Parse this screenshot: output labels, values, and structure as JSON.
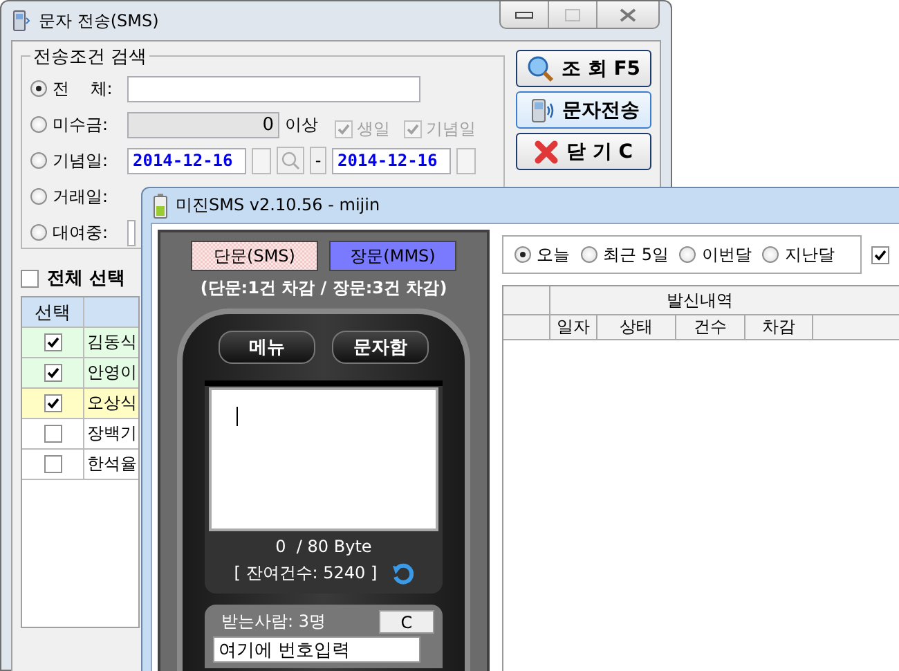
{
  "back_window": {
    "title": "문자 전송(SMS)",
    "search_group": {
      "title": "전송조건 검색",
      "options": [
        {
          "kind": "text",
          "label": "전    체:",
          "selected": true
        },
        {
          "kind": "amount",
          "label": "미수금:",
          "selected": false,
          "value": "0",
          "suffix": "이상",
          "checks": [
            {
              "label": "생일",
              "checked": true
            },
            {
              "label": "기념일",
              "checked": true
            }
          ]
        },
        {
          "kind": "date_range",
          "label": "기념일:",
          "selected": false,
          "from": "2014-12-16",
          "separator": "-",
          "to": "2014-12-16"
        },
        {
          "kind": "covered",
          "label": "거래일:",
          "selected": false
        },
        {
          "kind": "short_text",
          "label": "대여중:",
          "selected": false
        }
      ]
    },
    "buttons": [
      {
        "kind": "search",
        "label": "조 회 F5"
      },
      {
        "kind": "send",
        "label": "문자전송"
      },
      {
        "kind": "close",
        "label": "닫 기 C"
      }
    ],
    "select_all": {
      "label": "전체 선택",
      "checked": false
    },
    "table": {
      "columns": [
        "선택"
      ],
      "rows": [
        {
          "name": "김동식",
          "checked": true,
          "color": "#e4fce4"
        },
        {
          "name": "안영이",
          "checked": true,
          "color": "#e4fce4"
        },
        {
          "name": "오상식",
          "checked": true,
          "color": "#fffcc4"
        },
        {
          "name": "장백기",
          "checked": false,
          "color": "#ffffff"
        },
        {
          "name": "한석율",
          "checked": false,
          "color": "#ffffff"
        }
      ]
    }
  },
  "front_window": {
    "title": "미진SMS v2.10.56 - mijin",
    "message_types": [
      {
        "label": "단문(SMS)",
        "selected": false
      },
      {
        "label": "장문(MMS)",
        "selected": true
      }
    ],
    "deduction_note": "(단문:1건 차감 / 장문:3건 차감)",
    "phone_buttons": [
      "메뉴",
      "문자함"
    ],
    "byte_count": "0  / 80 Byte",
    "remaining": "[ 잔여건수: 5240 ]",
    "recipients": {
      "label": "받는사람: 3명",
      "clear_button": "C",
      "input_value": "여기에 번호입력"
    },
    "periods": [
      {
        "label": "오늘",
        "selected": true
      },
      {
        "label": "최근 5일",
        "selected": false
      },
      {
        "label": "이번달",
        "selected": false
      },
      {
        "label": "지난달",
        "selected": false
      }
    ],
    "filter_checkbox": {
      "checked": true
    },
    "history_table": {
      "group_header": "발신내역",
      "columns": [
        "일자",
        "상태",
        "건수",
        "차감"
      ]
    }
  }
}
